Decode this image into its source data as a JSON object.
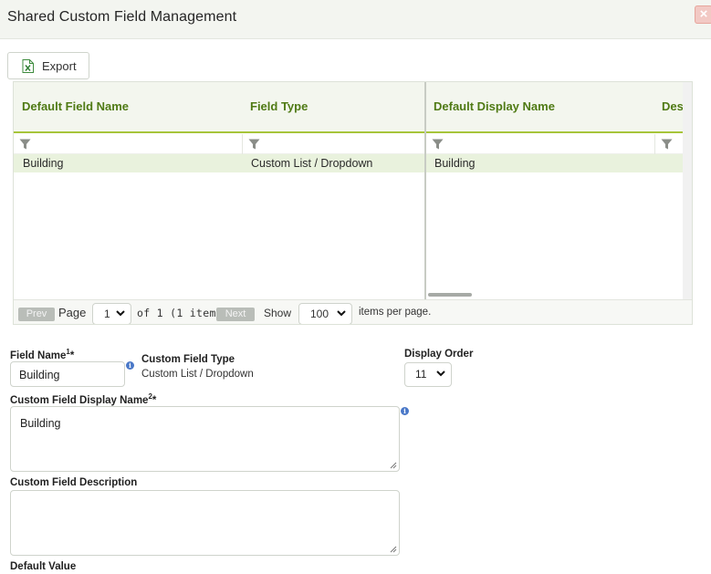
{
  "window": {
    "title": "Shared Custom Field Management",
    "close_label": "×"
  },
  "toolbar": {
    "export_label": "Export"
  },
  "grid": {
    "columns": [
      "Default Field Name",
      "Field Type",
      "Default Display Name",
      "Des"
    ],
    "rows": [
      {
        "field_name": "Building",
        "field_type": "Custom List / Dropdown",
        "display_name": "Building"
      }
    ],
    "pager": {
      "prev_label": "Prev",
      "page_label": "Page",
      "page_value": "1",
      "of_label": "of 1 (1 items)",
      "next_label": "Next",
      "show_label": "Show",
      "page_size_value": "100",
      "per_page_label": "items per page."
    }
  },
  "form": {
    "field_name_label": "Field Name",
    "field_name_sup": "1",
    "field_name_required": "*",
    "field_name_value": "Building",
    "custom_field_type_label": "Custom Field Type",
    "custom_field_type_value": "Custom List / Dropdown",
    "display_order_label": "Display Order",
    "display_order_value": "11",
    "display_name_label": "Custom Field Display Name",
    "display_name_sup": "2",
    "display_name_required": "*",
    "display_name_value": "Building",
    "description_label": "Custom Field Description",
    "description_value": "",
    "default_value_label": "Default Value"
  },
  "colors": {
    "accent_green": "#4f7a14",
    "header_underline": "#a7c53a",
    "selected_row": "#e9f2dd"
  }
}
